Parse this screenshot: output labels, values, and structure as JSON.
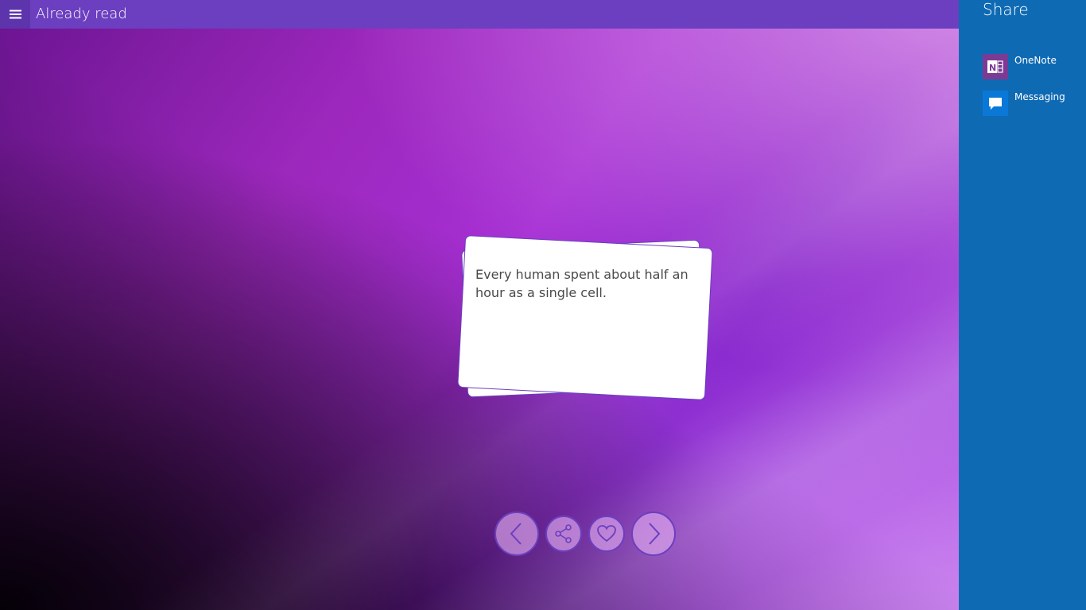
{
  "window": {
    "title": "Already read"
  },
  "card": {
    "text": "Every human spent about half an hour as a single cell."
  },
  "controls": {
    "previous_icon": "chevron-left-icon",
    "share_icon": "share-icon",
    "favorite_icon": "heart-icon",
    "next_icon": "chevron-right-icon"
  },
  "share": {
    "title": "Share",
    "targets": [
      {
        "label": "OneNote",
        "icon": "onenote-icon",
        "color": "#7b3b94"
      },
      {
        "label": "Messaging",
        "icon": "messaging-icon",
        "color": "#0a78d7"
      }
    ]
  },
  "colors": {
    "accent": "#6b3fbf",
    "share_panel": "#0f6ab4"
  }
}
